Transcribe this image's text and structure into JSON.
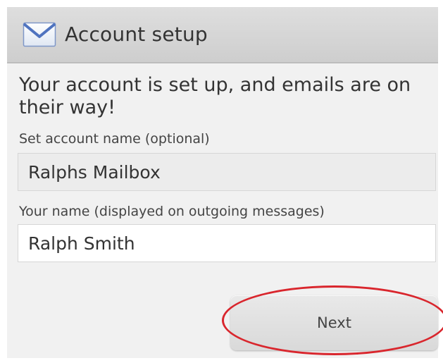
{
  "header": {
    "icon": "mail-icon",
    "title": "Account setup"
  },
  "message": "Your account is set up, and emails are on their way!",
  "fields": {
    "account_name": {
      "label": "Set account name (optional)",
      "value": "Ralphs Mailbox"
    },
    "your_name": {
      "label": "Your name (displayed on outgoing messages)",
      "value": "Ralph Smith"
    }
  },
  "actions": {
    "next_label": "Next"
  },
  "colors": {
    "header_bg": "#d6d6d6",
    "screen_bg": "#f1f1f1",
    "highlight": "#d9262d"
  }
}
